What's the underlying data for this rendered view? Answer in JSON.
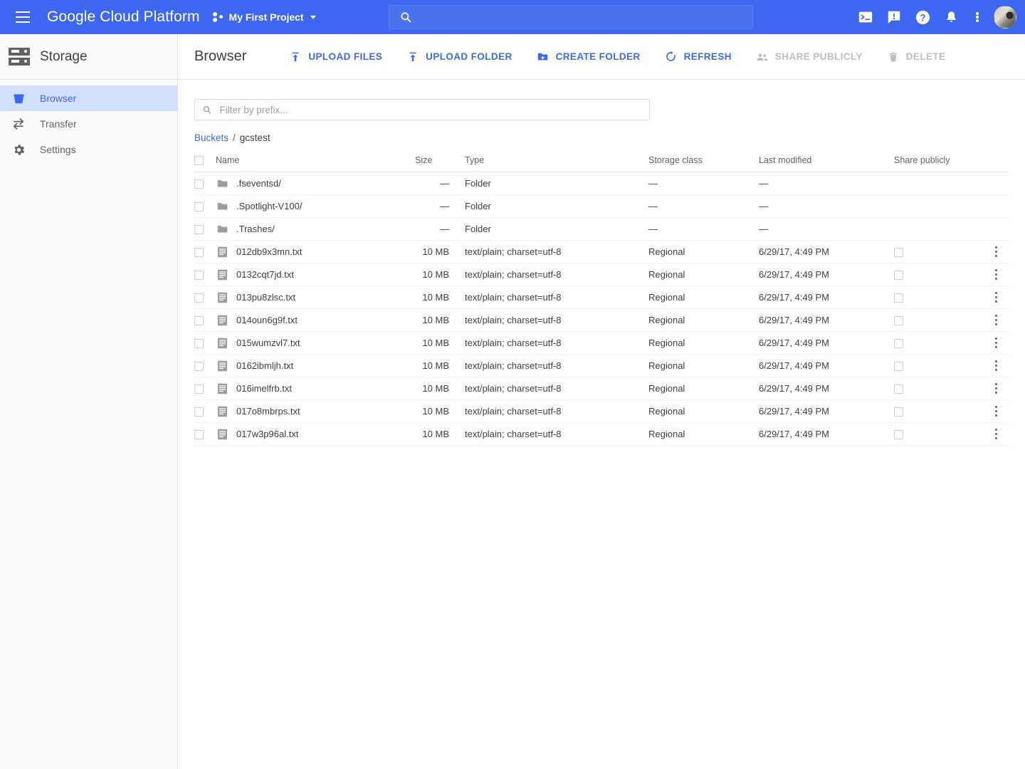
{
  "topbar": {
    "menu_icon": "hamburger-menu-icon",
    "brand": "Google Cloud Platform",
    "project_name": "My First Project",
    "project_icon": "project-dots-icon",
    "dropdown_icon": "chevron-down-icon",
    "search": {
      "value": "",
      "placeholder": "",
      "icon": "search-icon"
    },
    "icons": [
      {
        "name": "cloud-shell-icon",
        "glyph": "terminal"
      },
      {
        "name": "feedback-icon",
        "glyph": "speech-bubble-exclamation"
      },
      {
        "name": "help-icon",
        "glyph": "question-circle"
      },
      {
        "name": "notifications-icon",
        "glyph": "bell"
      },
      {
        "name": "more-options-icon",
        "glyph": "vertical-dots"
      },
      {
        "name": "account-avatar",
        "glyph": "user-photo"
      }
    ]
  },
  "sidebar": {
    "product_title": "Storage",
    "product_icon": "storage-rack-icon",
    "items": [
      {
        "label": "Browser",
        "icon": "bucket-icon",
        "selected": true
      },
      {
        "label": "Transfer",
        "icon": "transfer-icon",
        "selected": false
      },
      {
        "label": "Settings",
        "icon": "gear-icon",
        "selected": false
      }
    ]
  },
  "page": {
    "title": "Browser",
    "actions": [
      {
        "label": "UPLOAD FILES",
        "icon": "upload-file-icon",
        "disabled": false
      },
      {
        "label": "UPLOAD FOLDER",
        "icon": "upload-folder-icon",
        "disabled": false
      },
      {
        "label": "CREATE FOLDER",
        "icon": "create-folder-icon",
        "disabled": false
      },
      {
        "label": "REFRESH",
        "icon": "refresh-icon",
        "disabled": false
      },
      {
        "label": "SHARE PUBLICLY",
        "icon": "share-people-icon",
        "disabled": true
      },
      {
        "label": "DELETE",
        "icon": "trash-icon",
        "disabled": true
      }
    ],
    "filter": {
      "value": "",
      "placeholder": "Filter by prefix...",
      "icon": "search-icon"
    },
    "breadcrumb": {
      "root": "Buckets",
      "separator": "/",
      "current": "gcstest"
    }
  },
  "table": {
    "columns": [
      "Name",
      "Size",
      "Type",
      "Storage class",
      "Last modified",
      "Share publicly"
    ],
    "rows": [
      {
        "kind": "folder",
        "name": ".fseventsd/",
        "size": "—",
        "type": "Folder",
        "storage_class": "—",
        "last_modified": "—"
      },
      {
        "kind": "folder",
        "name": ".Spotlight-V100/",
        "size": "—",
        "type": "Folder",
        "storage_class": "—",
        "last_modified": "—"
      },
      {
        "kind": "folder",
        "name": ".Trashes/",
        "size": "—",
        "type": "Folder",
        "storage_class": "—",
        "last_modified": "—"
      },
      {
        "kind": "file",
        "name": "012db9x3mn.txt",
        "size": "10 MB",
        "type": "text/plain; charset=utf-8",
        "storage_class": "Regional",
        "last_modified": "6/29/17, 4:49 PM"
      },
      {
        "kind": "file",
        "name": "0132cqt7jd.txt",
        "size": "10 MB",
        "type": "text/plain; charset=utf-8",
        "storage_class": "Regional",
        "last_modified": "6/29/17, 4:49 PM"
      },
      {
        "kind": "file",
        "name": "013pu8zlsc.txt",
        "size": "10 MB",
        "type": "text/plain; charset=utf-8",
        "storage_class": "Regional",
        "last_modified": "6/29/17, 4:49 PM"
      },
      {
        "kind": "file",
        "name": "014oun6g9f.txt",
        "size": "10 MB",
        "type": "text/plain; charset=utf-8",
        "storage_class": "Regional",
        "last_modified": "6/29/17, 4:49 PM"
      },
      {
        "kind": "file",
        "name": "015wumzvl7.txt",
        "size": "10 MB",
        "type": "text/plain; charset=utf-8",
        "storage_class": "Regional",
        "last_modified": "6/29/17, 4:49 PM"
      },
      {
        "kind": "file",
        "name": "0162ibmljh.txt",
        "size": "10 MB",
        "type": "text/plain; charset=utf-8",
        "storage_class": "Regional",
        "last_modified": "6/29/17, 4:49 PM"
      },
      {
        "kind": "file",
        "name": "016imelfrb.txt",
        "size": "10 MB",
        "type": "text/plain; charset=utf-8",
        "storage_class": "Regional",
        "last_modified": "6/29/17, 4:49 PM"
      },
      {
        "kind": "file",
        "name": "017o8mbrps.txt",
        "size": "10 MB",
        "type": "text/plain; charset=utf-8",
        "storage_class": "Regional",
        "last_modified": "6/29/17, 4:49 PM"
      },
      {
        "kind": "file",
        "name": "017w3p96al.txt",
        "size": "10 MB",
        "type": "text/plain; charset=utf-8",
        "storage_class": "Regional",
        "last_modified": "6/29/17, 4:49 PM"
      }
    ]
  },
  "colors": {
    "brand_blue": "#3c67ee",
    "accent_blue": "#3c67ee",
    "sidebar_selected_bg": "#d2e0fb",
    "disabled_gray": "#bdbdbd",
    "text_primary": "#3c4043",
    "text_secondary": "#5f6368",
    "folder_icon_gray": "#9e9e9e",
    "file_icon_gray": "#9e9e9e"
  }
}
